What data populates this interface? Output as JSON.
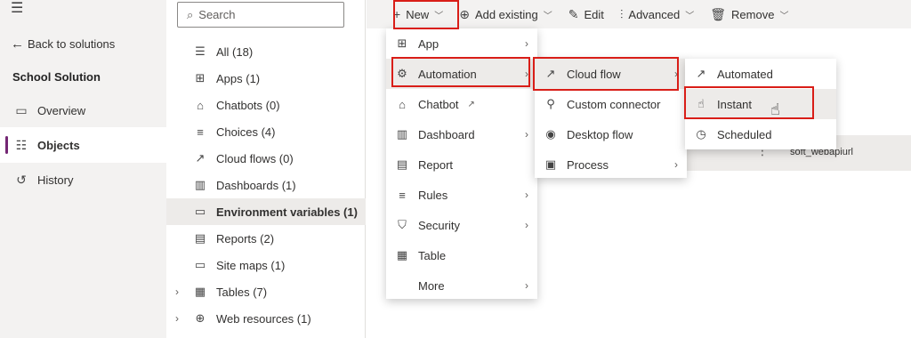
{
  "nav": {
    "back": "Back to solutions",
    "solution_name": "School Solution",
    "items": [
      {
        "label": "Overview",
        "icon": "overview-icon"
      },
      {
        "label": "Objects",
        "icon": "objects-icon"
      },
      {
        "label": "History",
        "icon": "history-icon"
      }
    ]
  },
  "search": {
    "placeholder": "Search"
  },
  "tree": {
    "items": [
      {
        "label": "All (18)"
      },
      {
        "label": "Apps (1)"
      },
      {
        "label": "Chatbots (0)"
      },
      {
        "label": "Choices (4)"
      },
      {
        "label": "Cloud flows (0)"
      },
      {
        "label": "Dashboards (1)"
      },
      {
        "label": "Environment variables (1)"
      },
      {
        "label": "Reports (2)"
      },
      {
        "label": "Site maps (1)"
      },
      {
        "label": "Tables (7)"
      },
      {
        "label": "Web resources (1)"
      }
    ]
  },
  "toolbar": {
    "new": "New",
    "add_existing": "Add existing",
    "edit": "Edit",
    "advanced": "Advanced",
    "remove": "Remove"
  },
  "new_menu": {
    "items": [
      {
        "label": "App"
      },
      {
        "label": "Automation"
      },
      {
        "label": "Chatbot"
      },
      {
        "label": "Dashboard"
      },
      {
        "label": "Report"
      },
      {
        "label": "Rules"
      },
      {
        "label": "Security"
      },
      {
        "label": "Table"
      },
      {
        "label": "More"
      }
    ]
  },
  "automation_menu": {
    "items": [
      {
        "label": "Cloud flow"
      },
      {
        "label": "Custom connector"
      },
      {
        "label": "Desktop flow"
      },
      {
        "label": "Process"
      }
    ]
  },
  "cloudflow_menu": {
    "items": [
      {
        "label": "Automated"
      },
      {
        "label": "Instant"
      },
      {
        "label": "Scheduled"
      }
    ]
  },
  "row": {
    "name": "soft_webapiurl"
  },
  "colors": {
    "accent": "#742774",
    "highlight": "#d91e18"
  }
}
